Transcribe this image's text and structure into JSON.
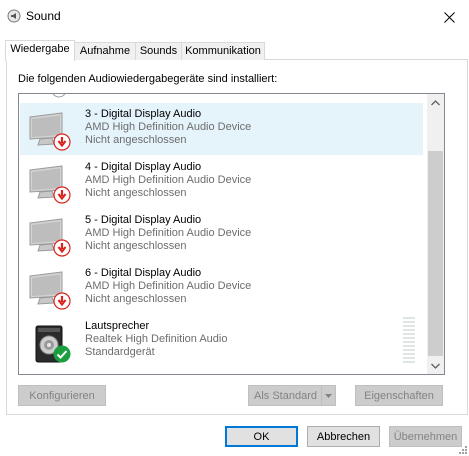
{
  "window": {
    "title": "Sound"
  },
  "tabs": [
    {
      "label": "Wiedergabe",
      "active": true
    },
    {
      "label": "Aufnahme"
    },
    {
      "label": "Sounds"
    },
    {
      "label": "Kommunikation"
    }
  ],
  "instruction": "Die folgenden Audiowiedergabegeräte sind installiert:",
  "devices": [
    {
      "name": "3 - Digital Display Audio",
      "driver": "AMD High Definition Audio Device",
      "status": "Nicht angeschlossen",
      "icon": "monitor-icon",
      "badge": "disconnected-arrow-icon",
      "selected": true
    },
    {
      "name": "4 - Digital Display Audio",
      "driver": "AMD High Definition Audio Device",
      "status": "Nicht angeschlossen",
      "icon": "monitor-icon",
      "badge": "disconnected-arrow-icon"
    },
    {
      "name": "5 - Digital Display Audio",
      "driver": "AMD High Definition Audio Device",
      "status": "Nicht angeschlossen",
      "icon": "monitor-icon",
      "badge": "disconnected-arrow-icon"
    },
    {
      "name": "6 - Digital Display Audio",
      "driver": "AMD High Definition Audio Device",
      "status": "Nicht angeschlossen",
      "icon": "monitor-icon",
      "badge": "disconnected-arrow-icon"
    },
    {
      "name": "Lautsprecher",
      "driver": "Realtek High Definition Audio",
      "status": "Standardgerät",
      "icon": "speaker-icon",
      "badge": "default-check-icon"
    }
  ],
  "buttons": {
    "configure": "Konfigurieren",
    "set_default": "Als Standard",
    "properties": "Eigenschaften",
    "ok": "OK",
    "cancel": "Abbrechen",
    "apply": "Übernehmen"
  },
  "colors": {
    "selection": "#e5f3fb",
    "accent": "#0078d7",
    "error_red": "#d9231d",
    "ok_green": "#1a9e3f"
  }
}
